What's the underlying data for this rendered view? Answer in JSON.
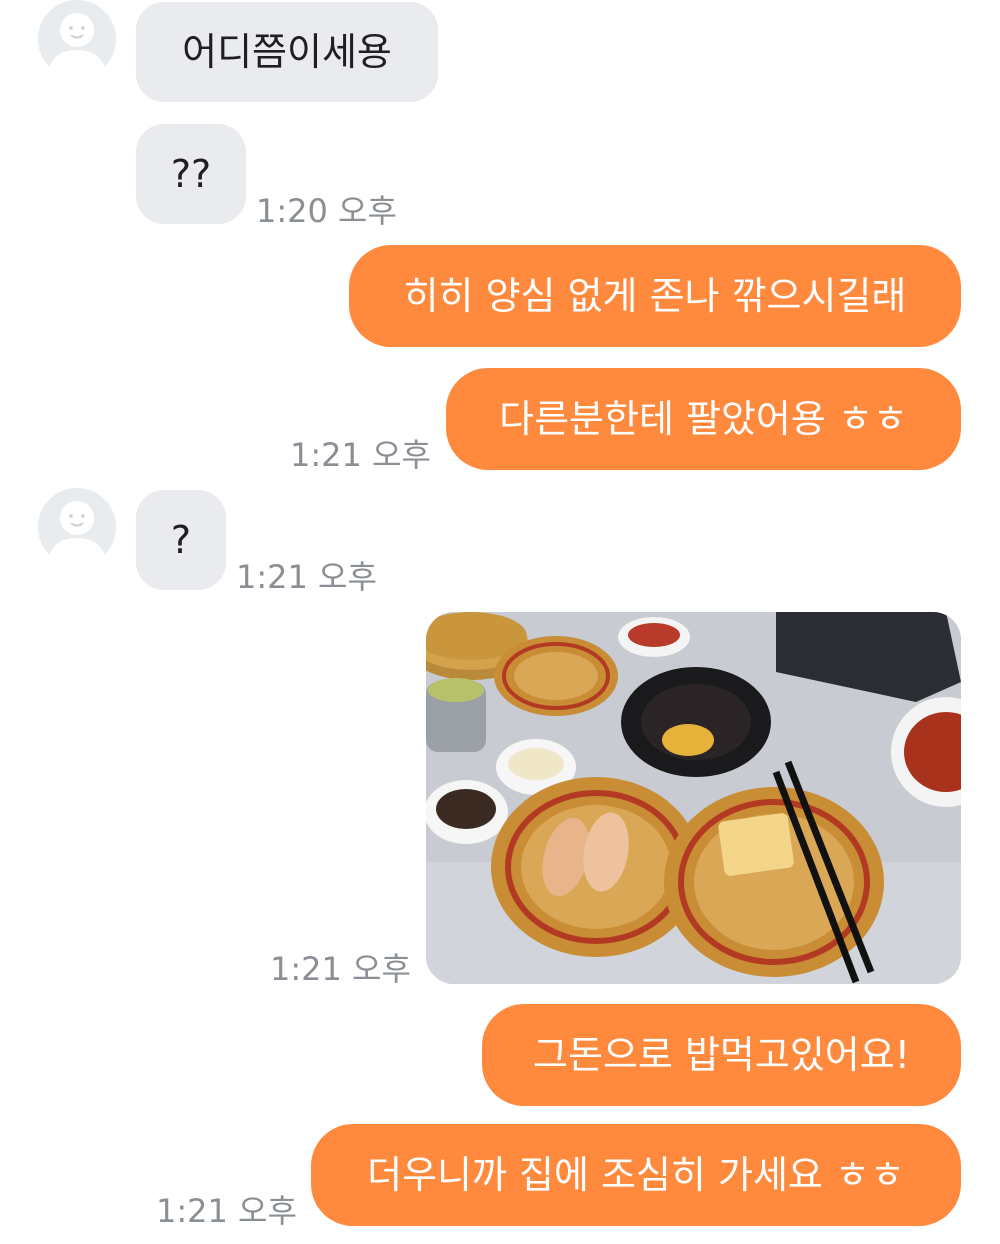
{
  "messages": [
    {
      "text": "어디쯤이세용"
    },
    {
      "text": "??",
      "time": "1:20 오후"
    },
    {
      "text": "히히 양심 없게 존나 깎으시길래"
    },
    {
      "text": "다른분한테 팔았어용 ㅎㅎ",
      "time": "1:21 오후"
    },
    {
      "text": "?",
      "time": "1:21 오후"
    },
    {
      "time": "1:21 오후"
    },
    {
      "text": "그돈으로 밥먹고있어요!"
    },
    {
      "text": "더우니까 집에 조심히 가세요 ㅎㅎ",
      "time": "1:21 오후"
    }
  ],
  "colors": {
    "outgoing_bubble": "#ff8a3d",
    "incoming_bubble": "#e9ebee",
    "timestamp": "#8a8f96"
  },
  "icons": {
    "avatar": "default-user-avatar-icon"
  }
}
